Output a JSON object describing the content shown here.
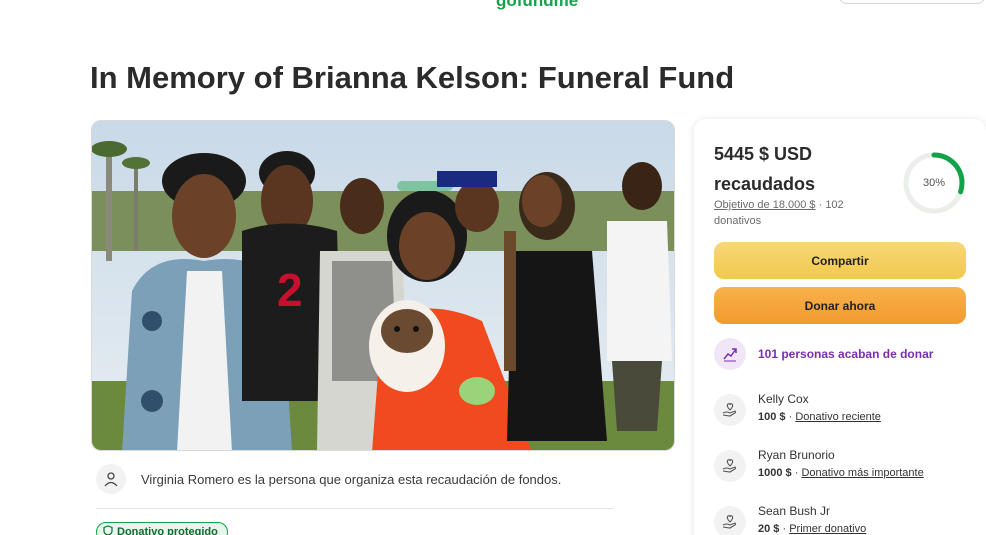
{
  "header": {
    "logo_text": "gofundme"
  },
  "page_title": "In Memory of Brianna Kelson: Funeral Fund",
  "organizer": {
    "text": "Virginia Romero es la persona que organiza esta recaudación de fondos."
  },
  "badge": {
    "label": "Donativo protegido"
  },
  "sidebar": {
    "raised_amount": "5445 $ USD",
    "raised_label": "recaudados",
    "goal_text": "Objetivo de 18.000 $",
    "separator": " · ",
    "donations_count": "102 donativos",
    "progress_label": "30%",
    "progress_value": 0.3,
    "share_label": "Compartir",
    "donate_label": "Donar ahora",
    "recent_donors_text": "101 personas acaban de donar",
    "donors": [
      {
        "name": "Kelly Cox",
        "amount": "100 $",
        "sep": " · ",
        "tag": "Donativo reciente"
      },
      {
        "name": "Ryan Brunorio",
        "amount": "1000 $",
        "sep": " · ",
        "tag": "Donativo más importante"
      },
      {
        "name": "Sean Bush Jr",
        "amount": "20 $",
        "sep": " · ",
        "tag": "Primer donativo"
      }
    ]
  },
  "colors": {
    "brand_green": "#12a24a",
    "share_yellow": "#f2c94c",
    "donate_orange": "#f29a2e",
    "recent_purple": "#7b2db0"
  }
}
